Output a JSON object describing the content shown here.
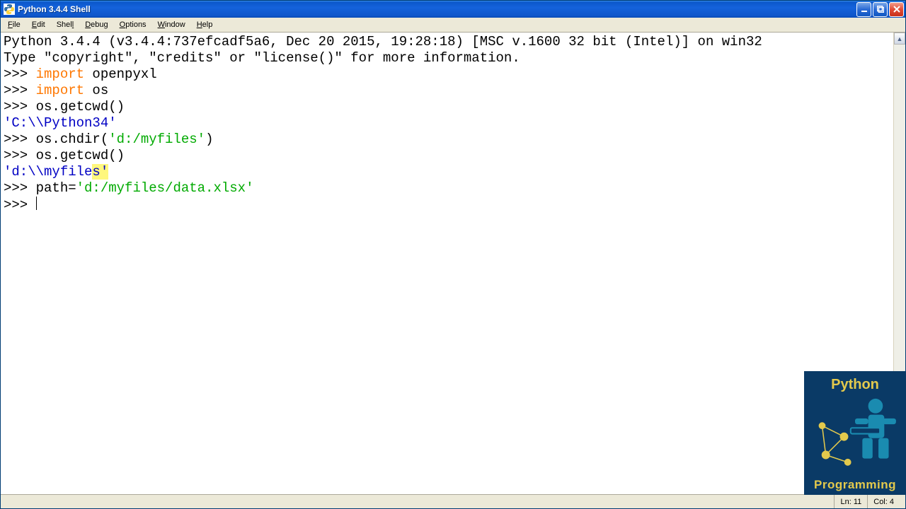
{
  "window": {
    "title": "Python 3.4.4 Shell"
  },
  "menu": {
    "file": "File",
    "edit": "Edit",
    "shell": "Shell",
    "debug": "Debug",
    "options": "Options",
    "window": "Window",
    "help": "Help"
  },
  "banner": {
    "line1": "Python 3.4.4 (v3.4.4:737efcadf5a6, Dec 20 2015, 19:28:18) [MSC v.1600 32 bit (Intel)] on win32",
    "line2": "Type \"copyright\", \"credits\" or \"license()\" for more information."
  },
  "prompt": ">>> ",
  "code": {
    "kw_import": "import",
    "mod1": " openpyxl",
    "mod2": " os",
    "getcwd": "os.getcwd()",
    "out1": "'C:\\\\Python34'",
    "chdir_pre": "os.chdir(",
    "chdir_str": "'d:/myfiles'",
    "chdir_post": ")",
    "out2_pre": "'d:\\\\myfile",
    "out2_sel": "s'",
    "path_pre": "path=",
    "path_str": "'d:/myfiles/data.xlsx'"
  },
  "status": {
    "ln": "Ln: 11",
    "col": "Col: 4"
  },
  "watermark": {
    "top": "Python",
    "bottom": "Programming"
  }
}
